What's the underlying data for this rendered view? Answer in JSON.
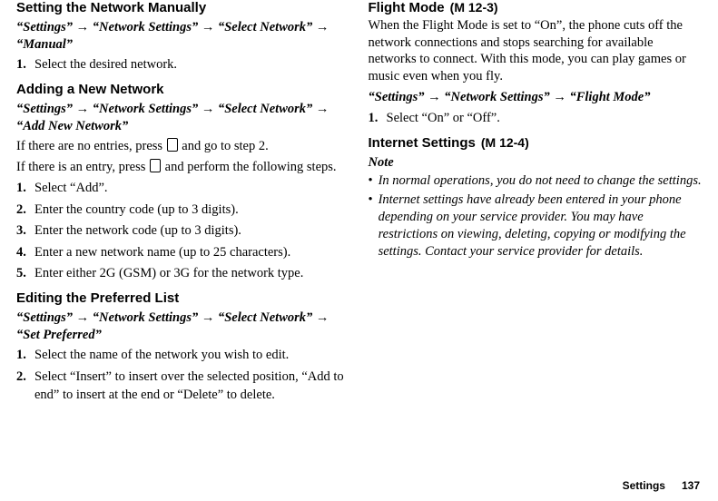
{
  "left": {
    "sec1": {
      "title": "Setting the Network Manually",
      "path": "“Settings” → “Network Settings” → “Select Network” → “Manual”",
      "steps": [
        "Select the desired network."
      ]
    },
    "sec2": {
      "title": "Adding a New Network",
      "path": "“Settings” → “Network Settings” → “Select Network” → “Add New Network”",
      "intro1a": "If there are no entries, press ",
      "intro1b": " and go to step 2.",
      "intro2a": "If there is an entry, press ",
      "intro2b": " and perform the following steps.",
      "steps": [
        "Select “Add”.",
        "Enter the country code (up to 3 digits).",
        "Enter the network code (up to 3 digits).",
        "Enter a new network name (up to 25 characters).",
        "Enter either 2G (GSM) or 3G for the network type."
      ]
    },
    "sec3": {
      "title": "Editing the Preferred List",
      "path": "“Settings” → “Network Settings” → “Select Network” → “Set Preferred”",
      "steps": [
        "Select the name of the network you wish to edit.",
        "Select “Insert” to insert over the selected position, “Add to end” to insert at the end or “Delete” to delete."
      ]
    }
  },
  "right": {
    "flight": {
      "title": "Flight Mode",
      "tag": "(M 12-3)",
      "desc": "When the Flight Mode is set to “On”, the phone cuts off the network connections and stops searching for available networks to connect. With this mode, you can play games or music even when you fly.",
      "path": "“Settings” → “Network Settings” → “Flight Mode”",
      "steps": [
        "Select “On” or “Off”."
      ]
    },
    "internet": {
      "title": "Internet Settings",
      "tag": "(M 12-4)",
      "note_label": "Note",
      "notes": [
        "In normal operations, you do not need to change the settings.",
        "Internet settings have already been entered in your phone depending on your service provider. You may have restrictions on viewing, deleting, copying or modifying the settings. Contact your service provider for details."
      ]
    }
  },
  "footer": {
    "label": "Settings",
    "page": "137"
  }
}
